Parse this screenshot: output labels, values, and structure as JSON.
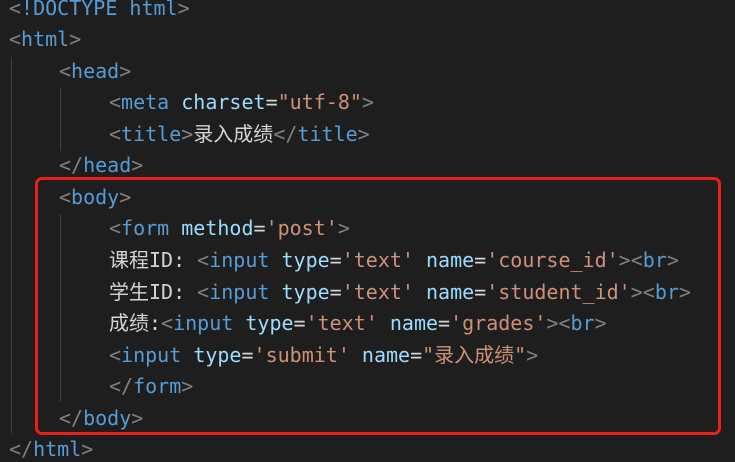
{
  "code": {
    "lines": [
      {
        "segments": [
          {
            "cls": "punct",
            "text": "<"
          },
          {
            "cls": "doctype",
            "text": "!DOCTYPE html"
          },
          {
            "cls": "punct",
            "text": ">"
          }
        ]
      },
      {
        "segments": [
          {
            "cls": "punct",
            "text": "<"
          },
          {
            "cls": "tag",
            "text": "html"
          },
          {
            "cls": "punct",
            "text": ">"
          }
        ]
      },
      {
        "segments": [
          {
            "cls": "punct",
            "text": "<"
          },
          {
            "cls": "tag",
            "text": "head"
          },
          {
            "cls": "punct",
            "text": ">"
          }
        ]
      },
      {
        "segments": [
          {
            "cls": "punct",
            "text": "<"
          },
          {
            "cls": "tag",
            "text": "meta"
          },
          {
            "cls": "txt",
            "text": " "
          },
          {
            "cls": "attr",
            "text": "charset"
          },
          {
            "cls": "txt",
            "text": "="
          },
          {
            "cls": "str",
            "text": "\"utf-8\""
          },
          {
            "cls": "punct",
            "text": ">"
          }
        ]
      },
      {
        "segments": [
          {
            "cls": "punct",
            "text": "<"
          },
          {
            "cls": "tag",
            "text": "title"
          },
          {
            "cls": "punct",
            "text": ">"
          },
          {
            "cls": "txt",
            "text": "录入成绩"
          },
          {
            "cls": "punct",
            "text": "</"
          },
          {
            "cls": "tag",
            "text": "title"
          },
          {
            "cls": "punct",
            "text": ">"
          }
        ]
      },
      {
        "segments": [
          {
            "cls": "punct",
            "text": "</"
          },
          {
            "cls": "tag",
            "text": "head"
          },
          {
            "cls": "punct",
            "text": ">"
          }
        ]
      },
      {
        "segments": [
          {
            "cls": "punct",
            "text": "<"
          },
          {
            "cls": "tag",
            "text": "body"
          },
          {
            "cls": "punct",
            "text": ">"
          }
        ]
      },
      {
        "segments": [
          {
            "cls": "punct",
            "text": "<"
          },
          {
            "cls": "tag",
            "text": "form"
          },
          {
            "cls": "txt",
            "text": " "
          },
          {
            "cls": "attr",
            "text": "method"
          },
          {
            "cls": "txt",
            "text": "="
          },
          {
            "cls": "str",
            "text": "'post'"
          },
          {
            "cls": "punct",
            "text": ">"
          }
        ]
      },
      {
        "segments": [
          {
            "cls": "txt",
            "text": "课程ID: "
          },
          {
            "cls": "punct",
            "text": "<"
          },
          {
            "cls": "tag",
            "text": "input"
          },
          {
            "cls": "txt",
            "text": " "
          },
          {
            "cls": "attr",
            "text": "type"
          },
          {
            "cls": "txt",
            "text": "="
          },
          {
            "cls": "str",
            "text": "'text'"
          },
          {
            "cls": "txt",
            "text": " "
          },
          {
            "cls": "attr",
            "text": "name"
          },
          {
            "cls": "txt",
            "text": "="
          },
          {
            "cls": "str",
            "text": "'course_id'"
          },
          {
            "cls": "punct",
            "text": "><"
          },
          {
            "cls": "tag",
            "text": "br"
          },
          {
            "cls": "punct",
            "text": ">"
          }
        ]
      },
      {
        "segments": [
          {
            "cls": "txt",
            "text": "学生ID: "
          },
          {
            "cls": "punct",
            "text": "<"
          },
          {
            "cls": "tag",
            "text": "input"
          },
          {
            "cls": "txt",
            "text": " "
          },
          {
            "cls": "attr",
            "text": "type"
          },
          {
            "cls": "txt",
            "text": "="
          },
          {
            "cls": "str",
            "text": "'text'"
          },
          {
            "cls": "txt",
            "text": " "
          },
          {
            "cls": "attr",
            "text": "name"
          },
          {
            "cls": "txt",
            "text": "="
          },
          {
            "cls": "str",
            "text": "'student_id'"
          },
          {
            "cls": "punct",
            "text": "><"
          },
          {
            "cls": "tag",
            "text": "br"
          },
          {
            "cls": "punct",
            "text": ">"
          }
        ]
      },
      {
        "segments": [
          {
            "cls": "txt",
            "text": "成绩:"
          },
          {
            "cls": "punct",
            "text": "<"
          },
          {
            "cls": "tag",
            "text": "input"
          },
          {
            "cls": "txt",
            "text": " "
          },
          {
            "cls": "attr",
            "text": "type"
          },
          {
            "cls": "txt",
            "text": "="
          },
          {
            "cls": "str",
            "text": "'text'"
          },
          {
            "cls": "txt",
            "text": " "
          },
          {
            "cls": "attr",
            "text": "name"
          },
          {
            "cls": "txt",
            "text": "="
          },
          {
            "cls": "str",
            "text": "'grades'"
          },
          {
            "cls": "punct",
            "text": "><"
          },
          {
            "cls": "tag",
            "text": "br"
          },
          {
            "cls": "punct",
            "text": ">"
          }
        ]
      },
      {
        "segments": [
          {
            "cls": "punct",
            "text": "<"
          },
          {
            "cls": "tag",
            "text": "input"
          },
          {
            "cls": "txt",
            "text": " "
          },
          {
            "cls": "attr",
            "text": "type"
          },
          {
            "cls": "txt",
            "text": "="
          },
          {
            "cls": "str",
            "text": "'submit'"
          },
          {
            "cls": "txt",
            "text": " "
          },
          {
            "cls": "attr",
            "text": "name"
          },
          {
            "cls": "txt",
            "text": "="
          },
          {
            "cls": "str",
            "text": "\"录入成绩\""
          },
          {
            "cls": "punct",
            "text": ">"
          }
        ]
      },
      {
        "segments": [
          {
            "cls": "punct",
            "text": "</"
          },
          {
            "cls": "tag",
            "text": "form"
          },
          {
            "cls": "punct",
            "text": ">"
          }
        ]
      },
      {
        "segments": [
          {
            "cls": "punct",
            "text": "</"
          },
          {
            "cls": "tag",
            "text": "body"
          },
          {
            "cls": "punct",
            "text": ">"
          }
        ]
      },
      {
        "segments": [
          {
            "cls": "punct",
            "text": "</"
          },
          {
            "cls": "tag",
            "text": "html"
          },
          {
            "cls": "punct",
            "text": ">"
          }
        ]
      }
    ]
  },
  "colors": {
    "background": "#1e1e1e",
    "tag": "#569cd6",
    "attribute": "#9cdcfe",
    "string": "#ce9178",
    "text": "#d4d4d4",
    "highlight_border": "#e8201a"
  }
}
